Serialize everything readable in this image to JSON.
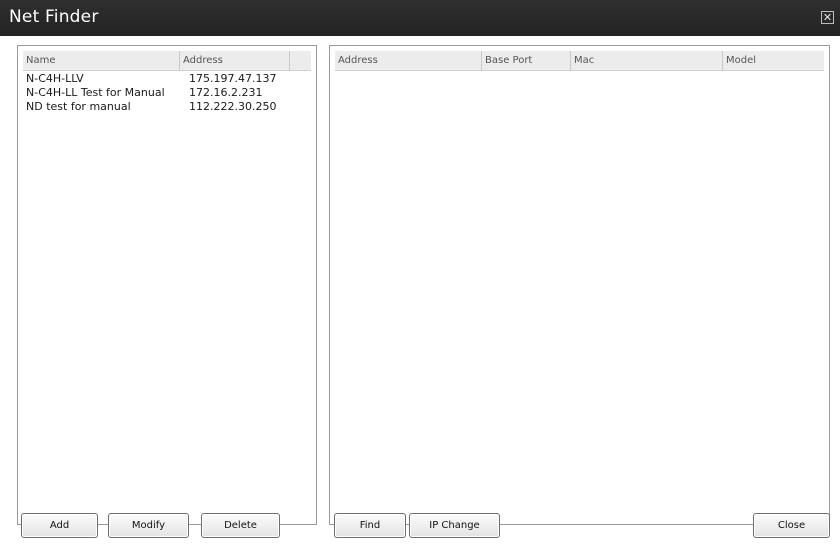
{
  "window": {
    "title": "Net Finder",
    "close_glyph": "✕"
  },
  "left_table": {
    "columns": [
      "Name",
      "Address"
    ],
    "rows": [
      {
        "name": "N-C4H-LLV",
        "address": "175.197.47.137"
      },
      {
        "name": "N-C4H-LL Test for Manual",
        "address": "172.16.2.231"
      },
      {
        "name": "ND test for manual",
        "address": "112.222.30.250"
      }
    ]
  },
  "right_table": {
    "columns": [
      "Address",
      "Base Port",
      "Mac",
      "Model"
    ],
    "rows": []
  },
  "buttons": {
    "add": "Add",
    "modify": "Modify",
    "delete": "Delete",
    "find": "Find",
    "ip_change": "IP Change",
    "close": "Close"
  }
}
